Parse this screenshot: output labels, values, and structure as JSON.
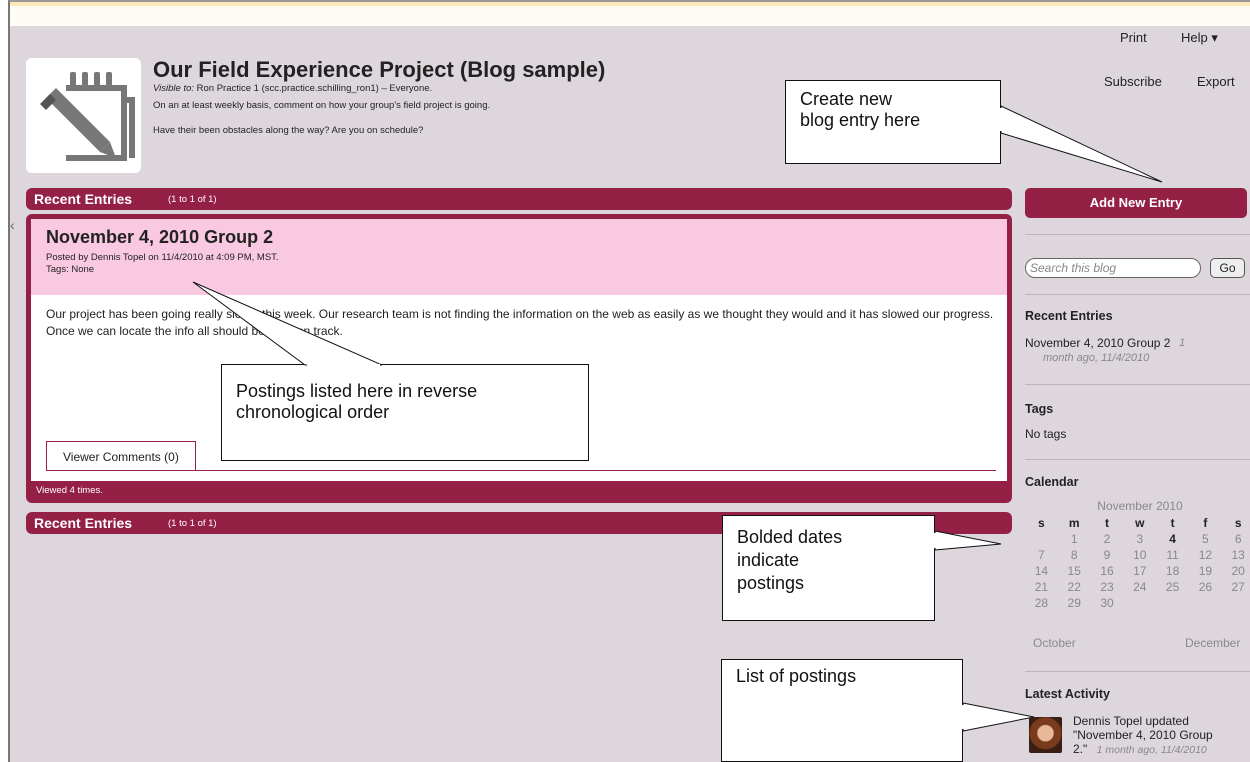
{
  "topbar": {
    "print": "Print",
    "help": "Help ▾",
    "subscribe": "Subscribe",
    "export": "Export"
  },
  "blog": {
    "title": "Our Field Experience Project (Blog sample)",
    "visible_label": "Visible to:",
    "visible_value": " Ron Practice 1 (scc.practice.schilling_ron1) – Everyone.",
    "description_1": "On an at least weekly basis, comment on how your group's field project is going.",
    "description_2": "Have their been obstacles along the way?  Are you on schedule?"
  },
  "recent_bar": {
    "title": "Recent Entries",
    "count": "(1 to 1 of 1)"
  },
  "entry": {
    "title": "November 4, 2010 Group 2",
    "posted_by": "Posted by Dennis Topel on 11/4/2010 at 4:09 PM, MST.",
    "tags": "Tags: None",
    "body": "Our project has been going really slowly this week.  Our research team is not finding the information on the web as easily as we thought they would and it has slowed our progress.  Once we can locate the info all should be back on track.",
    "comments_tab": "Viewer Comments (0)",
    "viewed": "Viewed 4 times."
  },
  "sidebar": {
    "add_entry": "Add New Entry",
    "search_placeholder": "Search this blog",
    "go": "Go",
    "recent_head": "Recent Entries",
    "recent_item": "November 4, 2010 Group 2",
    "recent_meta_1": "1",
    "recent_meta_2": "month ago, 11/4/2010",
    "tags_head": "Tags",
    "tags_value": "No tags",
    "calendar_head": "Calendar",
    "latest_head": "Latest Activity",
    "activity_1": "Dennis Topel updated",
    "activity_2": "\"November 4, 2010 Group",
    "activity_3": "2.\"",
    "activity_meta": "1 month ago, 11/4/2010"
  },
  "calendar": {
    "month": "November 2010",
    "weekdays": [
      "s",
      "m",
      "t",
      "w",
      "t",
      "f",
      "s"
    ],
    "weeks": [
      [
        "",
        "1",
        "2",
        "3",
        "4",
        "5",
        "6"
      ],
      [
        "7",
        "8",
        "9",
        "10",
        "11",
        "12",
        "13"
      ],
      [
        "14",
        "15",
        "16",
        "17",
        "18",
        "19",
        "20"
      ],
      [
        "21",
        "22",
        "23",
        "24",
        "25",
        "26",
        "27"
      ],
      [
        "28",
        "29",
        "30",
        "",
        "",
        "",
        ""
      ]
    ],
    "posted_days": [
      "4"
    ],
    "prev": "October",
    "next": "December"
  },
  "callouts": {
    "create": [
      "Create new",
      "blog entry here"
    ],
    "postings": [
      "Postings listed here in reverse",
      "chronological order"
    ],
    "bolded": [
      "Bolded dates",
      "indicate",
      "postings"
    ],
    "list": [
      "List of postings"
    ]
  },
  "colors": {
    "accent": "#952046",
    "entry_header": "#f8c9e0",
    "page_bg": "#ddd7dd"
  }
}
